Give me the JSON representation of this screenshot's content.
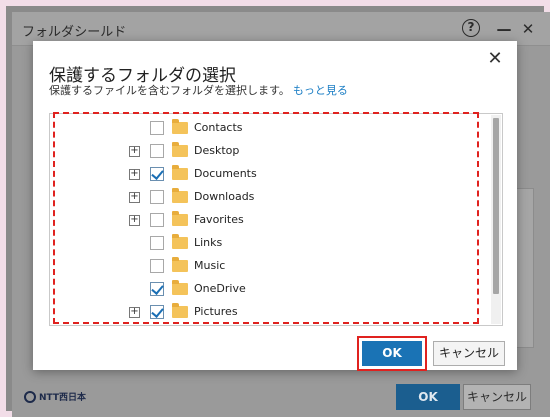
{
  "background_window": {
    "title": "フォルダシールド",
    "help_glyph": "?",
    "minimize_glyph": "—",
    "close_glyph": "✕",
    "footer": {
      "logo_text": "NTT西日本",
      "ok_label": "OK",
      "cancel_label": "キャンセル"
    }
  },
  "dialog": {
    "title": "保護するフォルダの選択",
    "subtitle": "保護するファイルを含むフォルダを選択します。",
    "more_link": "もっと見る",
    "close_glyph": "✕",
    "folders": [
      {
        "name": "Contacts",
        "expandable": false,
        "checked": false
      },
      {
        "name": "Desktop",
        "expandable": true,
        "checked": false
      },
      {
        "name": "Documents",
        "expandable": true,
        "checked": true
      },
      {
        "name": "Downloads",
        "expandable": true,
        "checked": false
      },
      {
        "name": "Favorites",
        "expandable": true,
        "checked": false
      },
      {
        "name": "Links",
        "expandable": false,
        "checked": false
      },
      {
        "name": "Music",
        "expandable": false,
        "checked": false
      },
      {
        "name": "OneDrive",
        "expandable": false,
        "checked": true
      },
      {
        "name": "Pictures",
        "expandable": true,
        "checked": true
      }
    ],
    "ok_label": "OK",
    "cancel_label": "キャンセル"
  },
  "colors": {
    "accent": "#1a73b5",
    "highlight": "#e0221f",
    "folder": "#f4c35a",
    "link": "#1a7dc4"
  }
}
